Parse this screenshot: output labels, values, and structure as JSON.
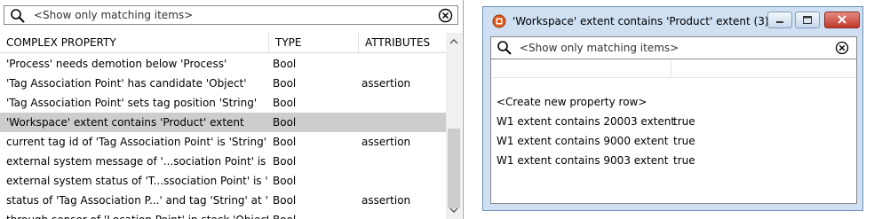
{
  "left_panel": {
    "search": {
      "placeholder": "<Show only matching items>"
    },
    "columns": {
      "property": "COMPLEX PROPERTY",
      "type": "TYPE",
      "attributes": "ATTRIBUTES"
    },
    "rows": [
      {
        "property": "'Process' needs demotion below 'Process'",
        "type": "Bool",
        "attributes": ""
      },
      {
        "property": "'Tag Association Point' has candidate 'Object'",
        "type": "Bool",
        "attributes": "assertion"
      },
      {
        "property": "'Tag Association Point' sets tag position 'String'",
        "type": "Bool",
        "attributes": ""
      },
      {
        "property": "'Workspace' extent contains 'Product' extent",
        "type": "Bool",
        "attributes": "",
        "selected": true
      },
      {
        "property": "current tag id of 'Tag Association Point' is 'String'",
        "type": "Bool",
        "attributes": "assertion"
      },
      {
        "property": "external system message of '...sociation Point' is 'String'",
        "type": "Bool",
        "attributes": ""
      },
      {
        "property": "external system status of 'T...ssociation Point' is 'String'",
        "type": "Bool",
        "attributes": ""
      },
      {
        "property": "status of 'Tag Association P...' and tag 'String' at 'Time'",
        "type": "Bool",
        "attributes": "assertion"
      },
      {
        "property": "through sensor of 'Location Point' in stock 'Object' ...",
        "type": "Bool",
        "attributes": ""
      }
    ]
  },
  "popup": {
    "title": "'Workspace' extent contains 'Product' extent (3)",
    "search": {
      "placeholder": "<Show only matching items>"
    },
    "new_row": "<Create new property row>",
    "rows": [
      {
        "key": "W1 extent contains 20003 extent",
        "value": "true"
      },
      {
        "key": "W1 extent contains 9000 extent",
        "value": "true"
      },
      {
        "key": "W1 extent contains 9003 extent",
        "value": "true"
      }
    ]
  }
}
